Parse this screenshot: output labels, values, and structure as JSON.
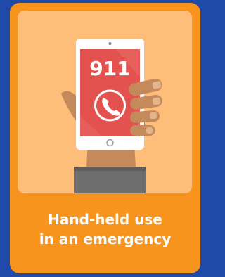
{
  "card": {
    "caption_line1": "Hand-held use",
    "caption_line2": "in an emergency"
  },
  "phone": {
    "number": "911",
    "icon": "phone-handset-icon"
  },
  "colors": {
    "background": "#1f4aa8",
    "card": "#f7941d",
    "panel": "#ffbd7a",
    "phone_screen": "#e3524f",
    "sleeve": "#6e6e6e",
    "skin": "#c48a5c"
  }
}
